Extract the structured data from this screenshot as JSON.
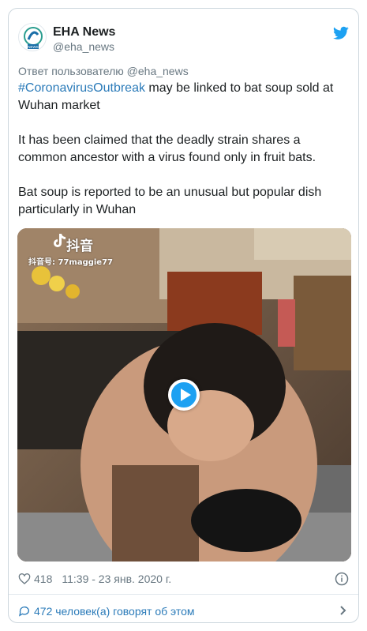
{
  "author": {
    "name": "EHA News",
    "handle": "@eha_news",
    "avatar_badge": "NEWS"
  },
  "reply_to": "Ответ пользователю @eha_news",
  "tweet": {
    "hashtag": "#CoronavirusOutbreak",
    "line1_rest": " may be linked to bat soup sold at Wuhan market",
    "paragraph2": "It has been claimed that the deadly strain shares a common ancestor with a virus found only in fruit bats.",
    "paragraph3": "Bat soup is reported to be an unusual but popular dish particularly in Wuhan"
  },
  "media": {
    "watermark_app": "抖音",
    "watermark_id": "抖音号: 77maggie77",
    "play_icon": "play-icon"
  },
  "meta": {
    "likes": "418",
    "timestamp": "11:39 - 23 янв. 2020 г."
  },
  "conversation": {
    "label": "472 человек(а) говорят об этом"
  },
  "colors": {
    "link": "#2b7bb9",
    "twitter_blue": "#1da1f2",
    "muted": "#697882",
    "border": "#ccd6dd"
  }
}
